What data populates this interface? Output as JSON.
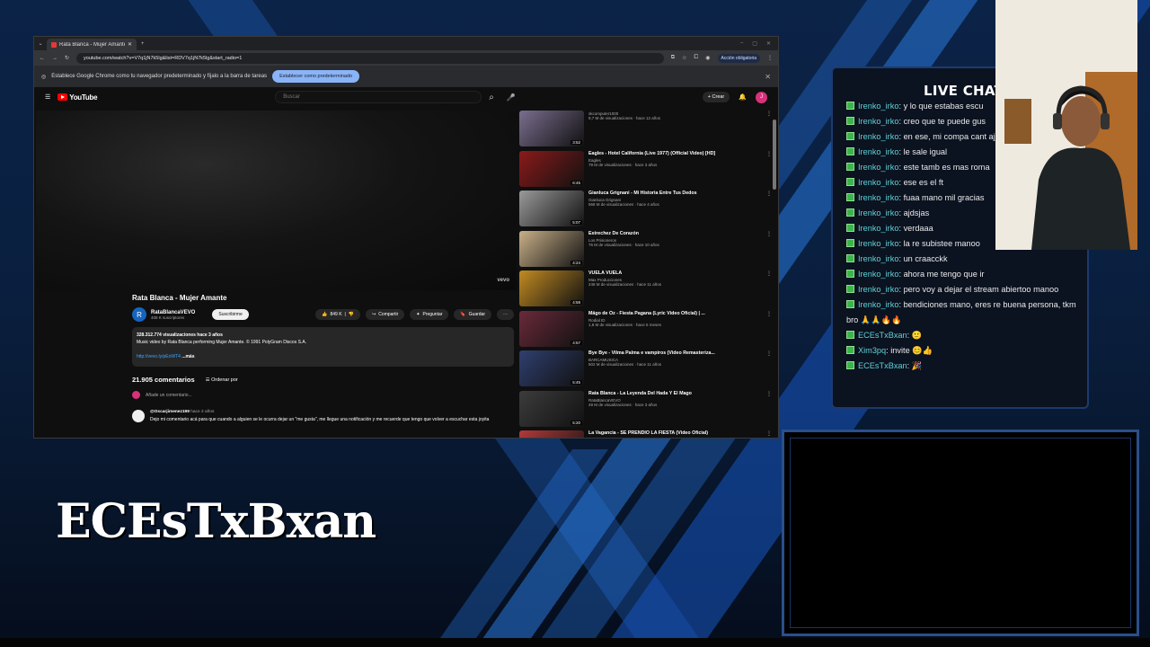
{
  "browser": {
    "tab_title": "Rata Blanca - Mujer Amante",
    "url": "youtube.com/watch?v=V7q1jN7k5lg&list=RDV7q1jN7k5lg&start_radio=1",
    "action_button": "Acción obligatoria",
    "infobar_text": "Establece Google Chrome como tu navegador predeterminado y fíjalo a la barra de tareas",
    "infobar_button": "Establecer como predeterminado"
  },
  "youtube": {
    "logo": "YouTube",
    "search_placeholder": "Buscar",
    "create_label": "Crear",
    "user_initial": "J",
    "watermark": "vevo",
    "video_title": "Rata Blanca - Mujer Amante",
    "channel_initial": "R",
    "channel_name": "RataBlancaVEVO",
    "channel_subs": "408 K suscriptores",
    "subscribe_label": "Suscribirme",
    "likes": "849 K",
    "share_label": "Compartir",
    "ask_label": "Preguntar",
    "save_label": "Guardar",
    "desc_stats": "328.312.774 visualizaciones  hace 3 años",
    "desc_text": "Music video by Rata Blanca performing Mujer Amante. © 1991 PolyGram Discos S.A.",
    "desc_link": "http://vevo.ly/pEoWT4",
    "desc_more": " ...más",
    "comment_count": "21.905 comentarios",
    "sort_label": "Ordenar por",
    "add_comment": "Añade un comentario...",
    "first_comment_user": "@Oscarjimenez199",
    "first_comment_age": " hace 2 años",
    "first_comment_text": "Dejo mi comentario acá para que cuando a alguien se le ocurra dejar un \"me gusta\", me llegue una notificación y me recuerde que tengo que volver a escuchar esta joyita"
  },
  "sidebar": [
    {
      "title": "",
      "channel": "skcomputer1000",
      "stats": "9,7 M de visualizaciones · hace 12 años",
      "duration": "3:52",
      "color": "#7a6e8f"
    },
    {
      "title": "Eagles - Hotel California (Live 1977) (Official Video) [HD]",
      "channel": "Eagles",
      "stats": "79 M de visualizaciones · hace 3 años",
      "duration": "6:45",
      "color": "#8b1a1a"
    },
    {
      "title": "Gianluca Grignani - Mi Historia Entre Tus Dedos",
      "channel": "Gianluca Grignani",
      "stats": "568 M de visualizaciones · hace 4 años",
      "duration": "5:07",
      "color": "#9a9a9a"
    },
    {
      "title": "Estrechez De Corazón",
      "channel": "Los Prisioneros",
      "stats": "76 M de visualizaciones · hace 10 años",
      "duration": "4:24",
      "color": "#c9b089"
    },
    {
      "title": "VUELA VUELA",
      "channel": "Max Producciones",
      "stats": "248 M de visualizaciones · hace 11 años",
      "duration": "4:58",
      "color": "#c28b22"
    },
    {
      "title": "Mägo de Oz - Fiesta Pagana (Lyric Video Oficial) | ...",
      "channel": "Rodial ID",
      "stats": "1,8 M de visualizaciones · hace 5 meses",
      "duration": "4:57",
      "color": "#6a2a3a"
    },
    {
      "title": "Bye Bye - Vilma Palma e vampiros (Video Remasteriza...",
      "channel": "BARCAMUSICA",
      "stats": "502 M de visualizaciones · hace 11 años",
      "duration": "5:45",
      "color": "#2f3f6f"
    },
    {
      "title": "Rata Blanca - La Leyenda Del Hada Y El Mago",
      "channel": "RataBlancaVEVO",
      "stats": "49 M de visualizaciones · hace 3 años",
      "duration": "5:20",
      "color": "#3c3c3c"
    },
    {
      "title": "La Vagancia - SE PRENDIO LA FIESTA (Video Oficial)",
      "channel": "La Vagancia",
      "stats": "",
      "duration": "",
      "color": "#b23a3a"
    }
  ],
  "chat": {
    "header": "LIVE CHAT",
    "messages": [
      {
        "user": "Irenko_irko",
        "text": "y lo que estabas escu"
      },
      {
        "user": "Irenko_irko",
        "text": "creo que te puede gus"
      },
      {
        "user": "Irenko_irko",
        "text": "en ese, mi compa cant ajjss"
      },
      {
        "user": "Irenko_irko",
        "text": "le sale igual"
      },
      {
        "user": "Irenko_irko",
        "text": "este tamb es mas roma"
      },
      {
        "user": "Irenko_irko",
        "text": "ese es el ft"
      },
      {
        "user": "Irenko_irko",
        "text": "fuaa mano mil gracias"
      },
      {
        "user": "Irenko_irko",
        "text": "ajdsjas"
      },
      {
        "user": "Irenko_irko",
        "text": "verdaaa"
      },
      {
        "user": "Irenko_irko",
        "text": "la re subistee manoo"
      },
      {
        "user": "Irenko_irko",
        "text": "un craacckk"
      },
      {
        "user": "Irenko_irko",
        "text": "ahora me tengo que ir"
      },
      {
        "user": "Irenko_irko",
        "text": "pero voy a dejar el stream abiertoo manoo"
      },
      {
        "user": "Irenko_irko",
        "text": "bendiciones mano, eres re buena persona, tkm bro 🙏🙏🔥🔥"
      },
      {
        "user": "ECEsTxBxan",
        "text": "🙂"
      },
      {
        "user": "Xim3pq",
        "text": "invite 😊👍"
      },
      {
        "user": "ECEsTxBxan",
        "text": "🎉"
      }
    ]
  },
  "overlay": {
    "streamer_name": "ECEsTxBxan"
  },
  "colors": {
    "chat_user": "#5fd3d8",
    "badge": "#3bb54a",
    "youtube_red": "#ff0000",
    "panel_border": "#1d3a6e"
  }
}
